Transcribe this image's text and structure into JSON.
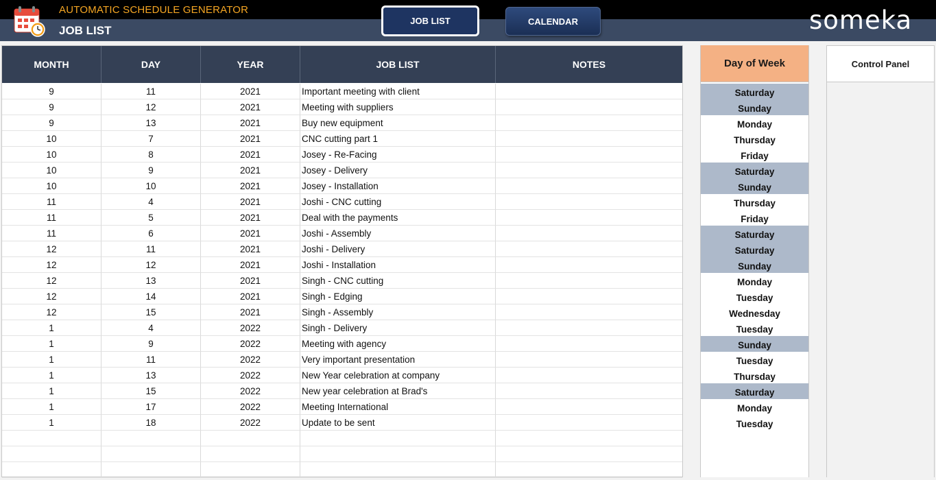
{
  "header": {
    "app_title": "AUTOMATIC SCHEDULE GENERATOR",
    "page_title": "JOB LIST",
    "nav": {
      "job_list": "JOB LIST",
      "calendar": "CALENDAR"
    },
    "logo": "someka",
    "icon": "calendar-clock-icon"
  },
  "columns": [
    "MONTH",
    "DAY",
    "YEAR",
    "JOB LIST",
    "NOTES"
  ],
  "rows": [
    {
      "month": "9",
      "day": "11",
      "year": "2021",
      "job": "Important meeting with client",
      "notes": ""
    },
    {
      "month": "9",
      "day": "12",
      "year": "2021",
      "job": "Meeting with suppliers",
      "notes": ""
    },
    {
      "month": "9",
      "day": "13",
      "year": "2021",
      "job": "Buy new equipment",
      "notes": ""
    },
    {
      "month": "10",
      "day": "7",
      "year": "2021",
      "job": "CNC cutting part 1",
      "notes": ""
    },
    {
      "month": "10",
      "day": "8",
      "year": "2021",
      "job": "Josey - Re-Facing",
      "notes": ""
    },
    {
      "month": "10",
      "day": "9",
      "year": "2021",
      "job": "Josey - Delivery",
      "notes": ""
    },
    {
      "month": "10",
      "day": "10",
      "year": "2021",
      "job": "Josey - Installation",
      "notes": ""
    },
    {
      "month": "11",
      "day": "4",
      "year": "2021",
      "job": "Joshi - CNC cutting",
      "notes": ""
    },
    {
      "month": "11",
      "day": "5",
      "year": "2021",
      "job": "Deal with the payments",
      "notes": ""
    },
    {
      "month": "11",
      "day": "6",
      "year": "2021",
      "job": "Joshi - Assembly",
      "notes": ""
    },
    {
      "month": "12",
      "day": "11",
      "year": "2021",
      "job": "Joshi - Delivery",
      "notes": ""
    },
    {
      "month": "12",
      "day": "12",
      "year": "2021",
      "job": "Joshi - Installation",
      "notes": ""
    },
    {
      "month": "12",
      "day": "13",
      "year": "2021",
      "job": "Singh - CNC cutting",
      "notes": ""
    },
    {
      "month": "12",
      "day": "14",
      "year": "2021",
      "job": "Singh - Edging",
      "notes": ""
    },
    {
      "month": "12",
      "day": "15",
      "year": "2021",
      "job": "Singh - Assembly",
      "notes": ""
    },
    {
      "month": "1",
      "day": "4",
      "year": "2022",
      "job": "Singh - Delivery",
      "notes": ""
    },
    {
      "month": "1",
      "day": "9",
      "year": "2022",
      "job": "Meeting with agency",
      "notes": ""
    },
    {
      "month": "1",
      "day": "11",
      "year": "2022",
      "job": "Very important presentation",
      "notes": ""
    },
    {
      "month": "1",
      "day": "13",
      "year": "2022",
      "job": "New Year celebration at company",
      "notes": ""
    },
    {
      "month": "1",
      "day": "15",
      "year": "2022",
      "job": "New year celebration at Brad's",
      "notes": ""
    },
    {
      "month": "1",
      "day": "17",
      "year": "2022",
      "job": "Meeting International",
      "notes": ""
    },
    {
      "month": "1",
      "day": "18",
      "year": "2022",
      "job": "Update to be sent",
      "notes": ""
    },
    {
      "month": "",
      "day": "",
      "year": "",
      "job": "",
      "notes": ""
    },
    {
      "month": "",
      "day": "",
      "year": "",
      "job": "",
      "notes": ""
    },
    {
      "month": "",
      "day": "",
      "year": "",
      "job": "",
      "notes": ""
    }
  ],
  "day_of_week": {
    "header": "Day of Week",
    "weekend_color": "#adb9ca",
    "days": [
      "Saturday",
      "Sunday",
      "Monday",
      "Thursday",
      "Friday",
      "Saturday",
      "Sunday",
      "Thursday",
      "Friday",
      "Saturday",
      "Saturday",
      "Sunday",
      "Monday",
      "Tuesday",
      "Wednesday",
      "Tuesday",
      "Sunday",
      "Tuesday",
      "Thursday",
      "Saturday",
      "Monday",
      "Tuesday"
    ]
  },
  "control_panel": {
    "header": "Control Panel"
  }
}
